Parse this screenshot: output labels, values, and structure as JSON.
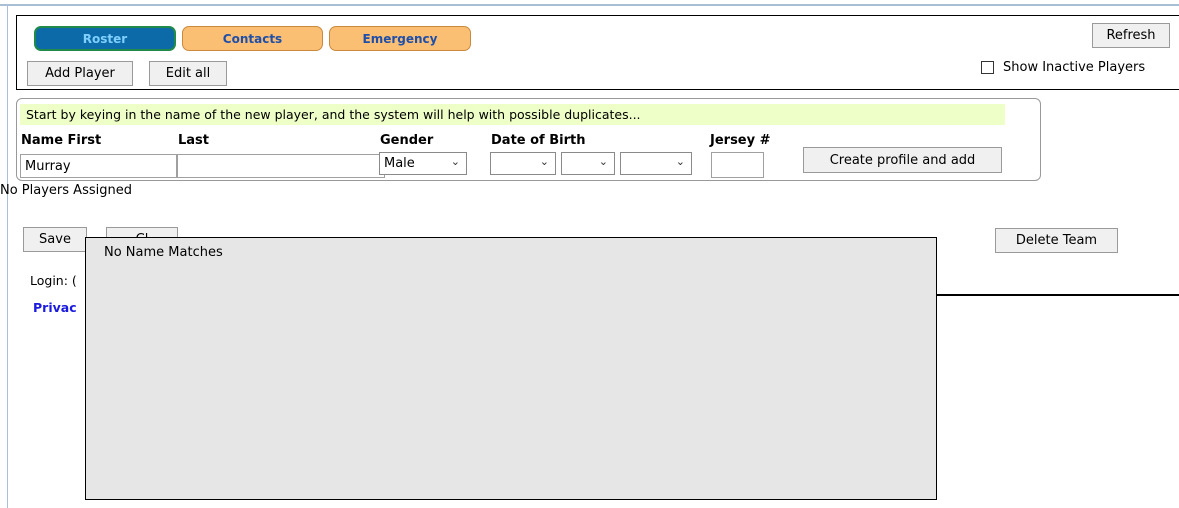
{
  "tabs": {
    "roster": "Roster",
    "contacts": "Contacts",
    "emergency": "Emergency"
  },
  "toolbar": {
    "refresh": "Refresh",
    "add_player": "Add Player",
    "edit_all": "Edit all",
    "show_inactive": "Show Inactive Players"
  },
  "form": {
    "hint": "Start by keying in the name of the new player, and the system will help with possible duplicates...",
    "label_name_first": "Name First",
    "label_last": "Last",
    "label_gender": "Gender",
    "label_dob": "Date of Birth",
    "label_jersey": "Jersey #",
    "first_value": "Murray",
    "last_value": "",
    "gender_value": "Male",
    "dob_month": "",
    "dob_day": "",
    "dob_year": "",
    "jersey_value": "",
    "create_button": "Create profile and add"
  },
  "status": {
    "no_players": "No Players Assigned"
  },
  "bottom": {
    "save": "Save",
    "clear_partial": "Cl",
    "delete_team": "Delete Team",
    "login_partial": "Login: (",
    "privacy_partial": "Privac"
  },
  "popup": {
    "message": "No Name Matches"
  }
}
